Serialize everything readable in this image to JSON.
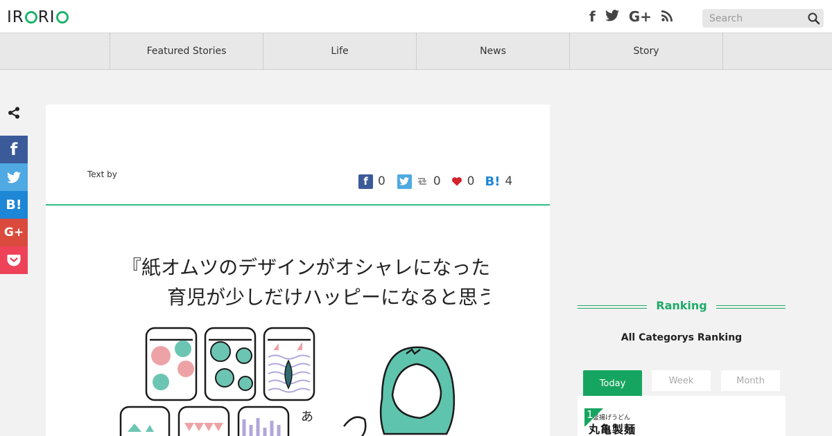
{
  "header": {
    "logo": "IRORIO",
    "social": [
      "facebook-icon",
      "twitter-icon",
      "google-plus-icon",
      "rss-icon"
    ],
    "search_placeholder": "Search"
  },
  "nav": {
    "items": [
      {
        "label": "Featured Stories"
      },
      {
        "label": "Life"
      },
      {
        "label": "News"
      },
      {
        "label": "Story"
      }
    ]
  },
  "share_rail": {
    "buttons": [
      {
        "icon": "facebook-icon",
        "color": "#3b5a9a"
      },
      {
        "icon": "twitter-icon",
        "color": "#4fa9e2"
      },
      {
        "label": "B!",
        "icon": "hatena-bookmark-icon",
        "color": "#1d86d6"
      },
      {
        "label": "G+",
        "icon": "google-plus-icon",
        "color": "#da4b3d"
      },
      {
        "icon": "pocket-icon",
        "color": "#ed4257"
      }
    ]
  },
  "article": {
    "text_by": "Text by",
    "counts": {
      "facebook": "0",
      "retweet": "0",
      "like": "0",
      "hatena_label": "B!",
      "hatena": "4"
    },
    "illustration_line1": "『紙オムツのデザインがオシャレになったら",
    "illustration_line2": "育児が少しだけハッピーになると思う』"
  },
  "sidebar": {
    "ranking_title": "Ranking",
    "ranking_subtitle": "All Categorys Ranking",
    "tabs": [
      "Today",
      "Week",
      "Month"
    ],
    "active_tab": "Today",
    "items": [
      {
        "rank": "1",
        "thumb_caption": "釜揚げうどん",
        "thumb_title": "丸亀製麺"
      }
    ]
  },
  "colors": {
    "accent": "#1faa69",
    "facebook": "#3b5a9a",
    "twitter": "#4fa9e2",
    "hatena": "#1d86d6",
    "google": "#da4b3d",
    "pocket": "#ed4257"
  }
}
